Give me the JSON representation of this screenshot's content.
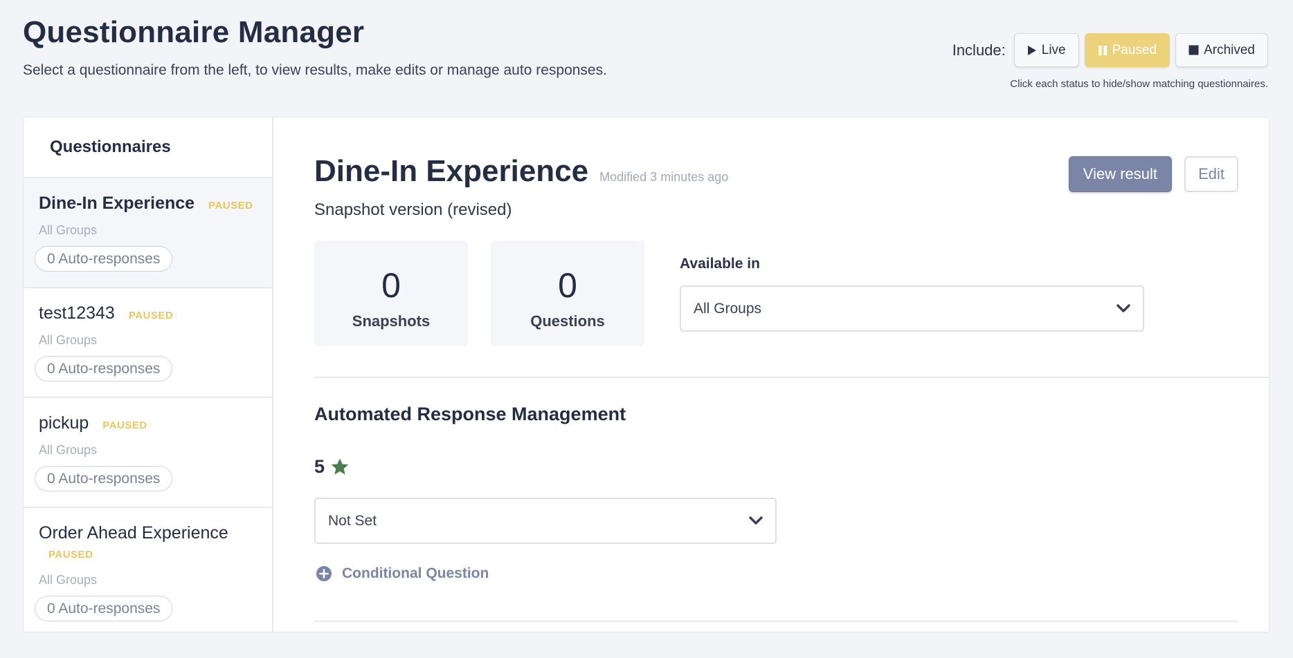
{
  "header": {
    "title": "Questionnaire Manager",
    "subtitle": "Select a questionnaire from the left, to view results, make edits or manage auto responses."
  },
  "filter": {
    "label": "Include:",
    "live": "Live",
    "paused": "Paused",
    "archived": "Archived",
    "active": "Paused",
    "hint": "Click each status to hide/show matching questionnaires.",
    "active_color": "#ecd27a"
  },
  "sidebar": {
    "title": "Questionnaires",
    "items": [
      {
        "name": "Dine-In Experience",
        "status": "PAUSED",
        "groups": "All Groups",
        "auto": "0 Auto-responses"
      },
      {
        "name": "test12343",
        "status": "PAUSED",
        "groups": "All Groups",
        "auto": "0 Auto-responses"
      },
      {
        "name": "pickup",
        "status": "PAUSED",
        "groups": "All Groups",
        "auto": "0 Auto-responses"
      },
      {
        "name": "Order Ahead Experience",
        "status": "PAUSED",
        "groups": "All Groups",
        "auto": "0 Auto-responses"
      }
    ]
  },
  "detail": {
    "title": "Dine-In Experience",
    "modified": "Modified 3 minutes ago",
    "version": "Snapshot version (revised)",
    "view_button": "View result",
    "edit_button": "Edit",
    "snapshots_value": "0",
    "snapshots_label": "Snapshots",
    "questions_value": "0",
    "questions_label": "Questions",
    "available_label": "Available in",
    "available_value": "All Groups"
  },
  "automated": {
    "title": "Automated Response Management",
    "rating": "5",
    "star_color": "#4f7d52",
    "response_value": "Not Set",
    "conditional": "Conditional Question"
  }
}
